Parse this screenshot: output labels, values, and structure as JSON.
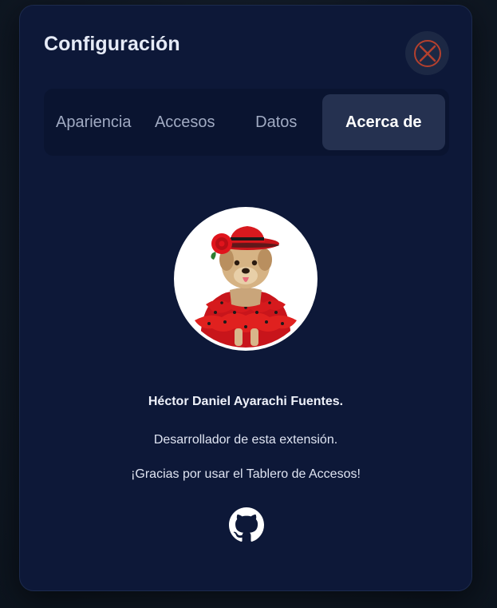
{
  "dialog": {
    "title": "Configuración",
    "close_icon": "close-circle-x-icon"
  },
  "tabs": [
    {
      "label": "Apariencia",
      "active": false
    },
    {
      "label": "Accesos",
      "active": false
    },
    {
      "label": "Datos",
      "active": false
    },
    {
      "label": "Acerca de",
      "active": true
    }
  ],
  "about": {
    "author_name": "Héctor Daniel Ayarachi Fuentes.",
    "role": "Desarrollador de esta extensión.",
    "thanks": "¡Gracias por usar el Tablero de Accesos!",
    "avatar_icon": "dog-in-flamenco-dress-avatar",
    "github_icon": "github-icon"
  },
  "colors": {
    "panel_bg": "#0d1838",
    "tabs_bg": "#0a1430",
    "active_tab_bg": "#253150",
    "close_accent": "#c0392b"
  }
}
